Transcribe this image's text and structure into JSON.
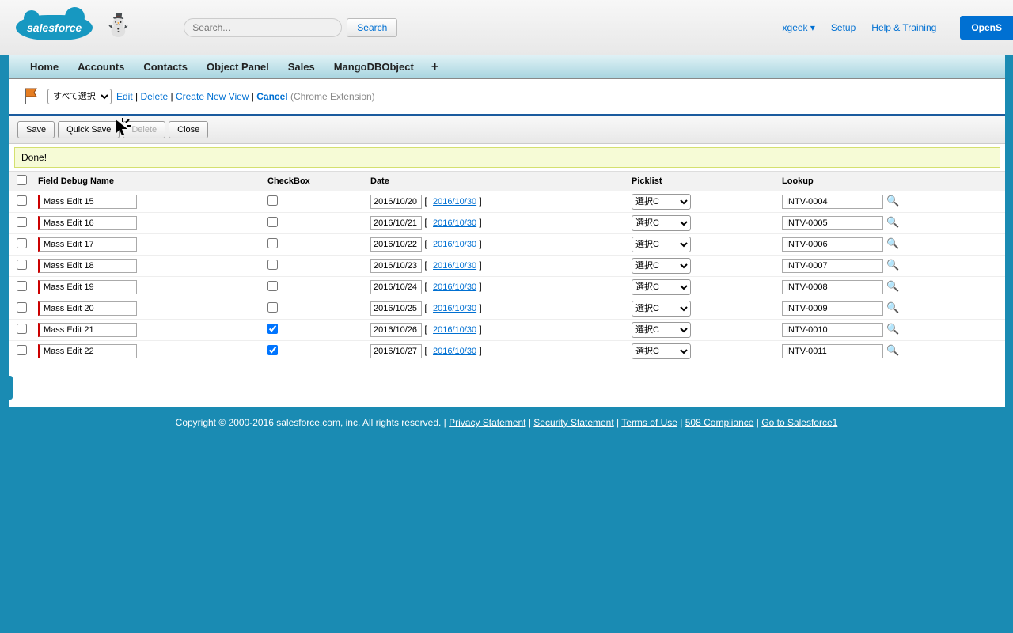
{
  "header": {
    "logo_text": "salesforce",
    "search_placeholder": "Search...",
    "search_button": "Search",
    "user": "xgeek",
    "setup": "Setup",
    "help": "Help & Training",
    "open_btn": "OpenS"
  },
  "tabs": [
    "Home",
    "Accounts",
    "Contacts",
    "Object Panel",
    "Sales",
    "MangoDBObject"
  ],
  "view": {
    "selected": "すべて選択",
    "edit": "Edit",
    "delete": "Delete",
    "create": "Create New View",
    "cancel": "Cancel",
    "extension": "(Chrome Extension)"
  },
  "actions": {
    "save": "Save",
    "quick_save": "Quick Save",
    "delete": "Delete",
    "close": "Close"
  },
  "done_msg": "Done!",
  "columns": {
    "debug": "Field Debug Name",
    "checkbox": "CheckBox",
    "date": "Date",
    "picklist": "Picklist",
    "lookup": "Lookup"
  },
  "date_link": "2016/10/30",
  "pick_value": "選択C",
  "rows": [
    {
      "name": "Mass Edit 15",
      "checked": false,
      "date": "2016/10/20",
      "lookup": "INTV-0004"
    },
    {
      "name": "Mass Edit 16",
      "checked": false,
      "date": "2016/10/21",
      "lookup": "INTV-0005"
    },
    {
      "name": "Mass Edit 17",
      "checked": false,
      "date": "2016/10/22",
      "lookup": "INTV-0006"
    },
    {
      "name": "Mass Edit 18",
      "checked": false,
      "date": "2016/10/23",
      "lookup": "INTV-0007"
    },
    {
      "name": "Mass Edit 19",
      "checked": false,
      "date": "2016/10/24",
      "lookup": "INTV-0008"
    },
    {
      "name": "Mass Edit 20",
      "checked": false,
      "date": "2016/10/25",
      "lookup": "INTV-0009"
    },
    {
      "name": "Mass Edit 21",
      "checked": true,
      "date": "2016/10/26",
      "lookup": "INTV-0010"
    },
    {
      "name": "Mass Edit 22",
      "checked": true,
      "date": "2016/10/27",
      "lookup": "INTV-0011"
    }
  ],
  "footer": {
    "copyright": "Copyright © 2000-2016 salesforce.com, inc. All rights reserved.",
    "privacy": "Privacy Statement",
    "security": "Security Statement",
    "terms": "Terms of Use",
    "compliance": "508 Compliance",
    "sf1": "Go to Salesforce1"
  }
}
